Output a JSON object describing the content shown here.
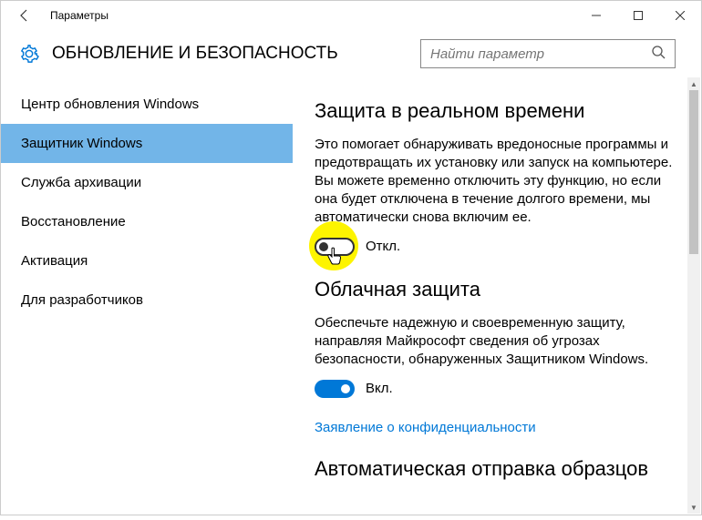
{
  "titlebar": {
    "app_title": "Параметры"
  },
  "header": {
    "heading": "ОБНОВЛЕНИЕ И БЕЗОПАСНОСТЬ",
    "search_placeholder": "Найти параметр"
  },
  "sidebar": {
    "items": [
      {
        "label": "Центр обновления Windows",
        "selected": false
      },
      {
        "label": "Защитник Windows",
        "selected": true
      },
      {
        "label": "Служба архивации",
        "selected": false
      },
      {
        "label": "Восстановление",
        "selected": false
      },
      {
        "label": "Активация",
        "selected": false
      },
      {
        "label": "Для разработчиков",
        "selected": false
      }
    ]
  },
  "main": {
    "section1": {
      "title": "Защита в реальном времени",
      "desc": "Это помогает обнаруживать вредоносные программы и предотвращать их установку или запуск на компьютере. Вы можете временно отключить эту функцию, но если она будет отключена в течение долгого времени, мы автоматически снова включим ее.",
      "toggle_state": "off",
      "toggle_label": "Откл."
    },
    "section2": {
      "title": "Облачная защита",
      "desc": "Обеспечьте надежную и своевременную защиту, направляя Майкрософт сведения об угрозах безопасности, обнаруженных Защитником Windows.",
      "toggle_state": "on",
      "toggle_label": "Вкл.",
      "link": "Заявление о конфиденциальности"
    },
    "section3": {
      "title": "Автоматическая отправка образцов"
    }
  }
}
